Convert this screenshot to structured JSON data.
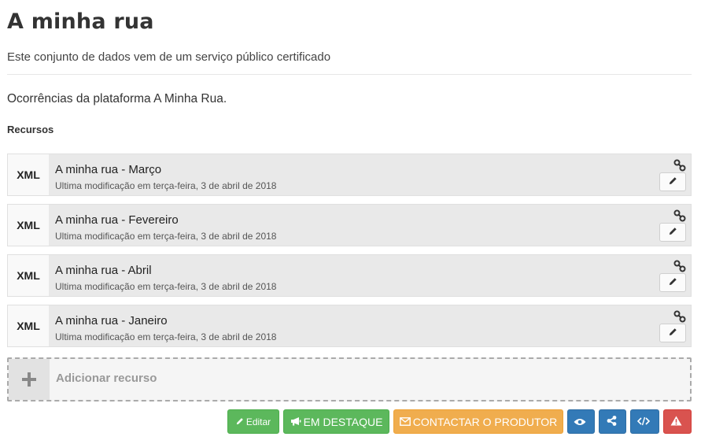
{
  "page": {
    "title": "A minha rua",
    "subtitle": "Este conjunto de dados vem de um serviço público certificado",
    "description": "Ocorrências da plataforma A Minha Rua."
  },
  "resources_section": {
    "title": "Recursos",
    "items": [
      {
        "format": "XML",
        "name": "A minha rua - Março",
        "modified": "Ultima modificação em terça-feira, 3 de abril de 2018"
      },
      {
        "format": "XML",
        "name": "A minha rua - Fevereiro",
        "modified": "Ultima modificação em terça-feira, 3 de abril de 2018"
      },
      {
        "format": "XML",
        "name": "A minha rua - Abril",
        "modified": "Ultima modificação em terça-feira, 3 de abril de 2018"
      },
      {
        "format": "XML",
        "name": "A minha rua - Janeiro",
        "modified": "Ultima modificação em terça-feira, 3 de abril de 2018"
      }
    ],
    "add_label": "Adicionar recurso"
  },
  "actions": {
    "edit_label": "Editar",
    "featured_label": "EM DESTAQUE",
    "contact_label": "CONTACTAR O PRODUTOR"
  },
  "icons": {
    "link": "link-icon",
    "pencil": "pencil-icon",
    "plus": "plus-icon",
    "bullhorn": "bullhorn-icon",
    "envelope": "envelope-icon",
    "eye": "eye-icon",
    "share": "share-icon",
    "code": "code-icon",
    "warning": "warning-icon"
  },
  "colors": {
    "green": "#5cb85c",
    "orange": "#f0ad4e",
    "blue": "#337ab7",
    "red": "#d9534f"
  }
}
